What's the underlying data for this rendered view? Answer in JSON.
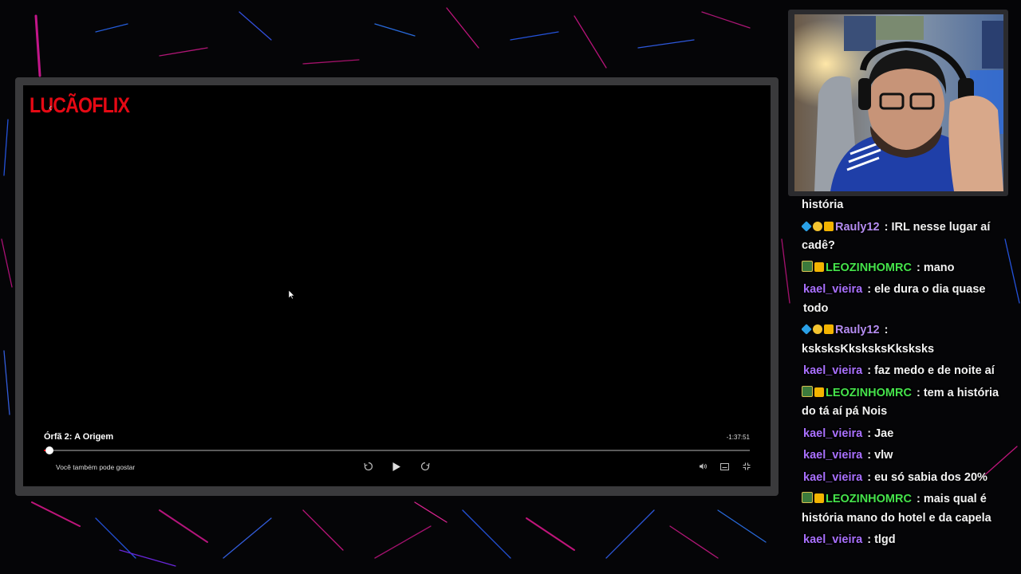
{
  "colors": {
    "accent_red": "#e50914",
    "chat_purple": "#a970ff",
    "chat_green": "#45e34b"
  },
  "player": {
    "logo": "LUCÃOFLIX",
    "title": "Órfã 2: A Origem",
    "time_remaining": "-1:37:51",
    "progress_fraction": 0.008,
    "suggest_label": "Você também pode gostar",
    "icons": {
      "back": "back-arrow-icon",
      "rewind": "rewind-10-icon",
      "play": "play-icon",
      "forward": "forward-10-icon",
      "volume": "volume-icon",
      "subtitles": "subtitles-icon",
      "fullscreen": "exit-fullscreen-icon"
    }
  },
  "chat": {
    "messages": [
      {
        "user": "",
        "text": "história",
        "badges": [],
        "color": ""
      },
      {
        "user": "Rauly12",
        "text": "IRL nesse lugar aí cadê?",
        "badges": [
          "prime",
          "sub",
          "crown"
        ],
        "color": "#b48cf0"
      },
      {
        "user": "LEOZINHOMRC",
        "text": "mano",
        "badges": [
          "avatar",
          "crown"
        ],
        "color": "#45e34b"
      },
      {
        "user": "kael_vieira",
        "text": "ele dura o dia quase todo",
        "badges": [],
        "color": "#a970ff"
      },
      {
        "user": "Rauly12",
        "text": "ksksksKksksksKksksks",
        "badges": [
          "prime",
          "sub",
          "crown"
        ],
        "color": "#b48cf0"
      },
      {
        "user": "kael_vieira",
        "text": "faz medo e de noite aí",
        "badges": [],
        "color": "#a970ff"
      },
      {
        "user": "LEOZINHOMRC",
        "text": "tem a história do tá aí pá Nois",
        "badges": [
          "avatar",
          "crown"
        ],
        "color": "#45e34b"
      },
      {
        "user": "kael_vieira",
        "text": "Jae",
        "badges": [],
        "color": "#a970ff"
      },
      {
        "user": "kael_vieira",
        "text": "vlw",
        "badges": [],
        "color": "#a970ff"
      },
      {
        "user": "kael_vieira",
        "text": "eu só sabia dos 20%",
        "badges": [],
        "color": "#a970ff"
      },
      {
        "user": "LEOZINHOMRC",
        "text": "mais qual é história mano do hotel e da capela",
        "badges": [
          "avatar",
          "crown"
        ],
        "color": "#45e34b"
      },
      {
        "user": "kael_vieira",
        "text": "tlgd",
        "badges": [],
        "color": "#a970ff"
      }
    ]
  }
}
